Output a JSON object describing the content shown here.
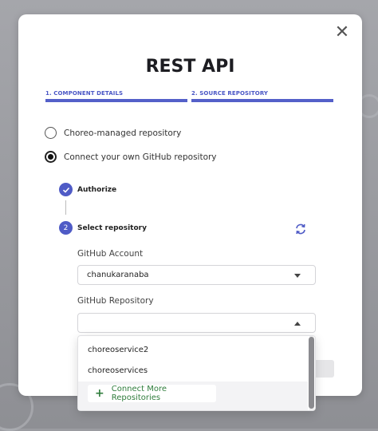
{
  "modal": {
    "title": "REST API",
    "close_icon": "close-icon"
  },
  "stepper": {
    "steps": [
      {
        "label": "1. COMPONENT DETAILS",
        "active": true
      },
      {
        "label": "2. SOURCE REPOSITORY",
        "active": true
      }
    ],
    "accent": "#4f5bc6"
  },
  "source_options": [
    {
      "label": "Choreo-managed repository",
      "selected": false
    },
    {
      "label": "Connect your own GitHub repository",
      "selected": true
    }
  ],
  "substeps": [
    {
      "number": "✓",
      "label": "Authorize",
      "completed": true
    },
    {
      "number": "2",
      "label": "Select repository",
      "completed": false
    }
  ],
  "refresh_icon": "refresh-icon",
  "github_account": {
    "label": "GitHub Account",
    "value": "chanukaranaba"
  },
  "github_repository": {
    "label": "GitHub Repository",
    "value": "",
    "open": true,
    "options": [
      "choreoservice2",
      "choreoservices"
    ],
    "connect_more_label": "Connect More Repositories"
  },
  "colors": {
    "primary": "#4f5bc6",
    "connect_green": "#2f7d3c"
  }
}
